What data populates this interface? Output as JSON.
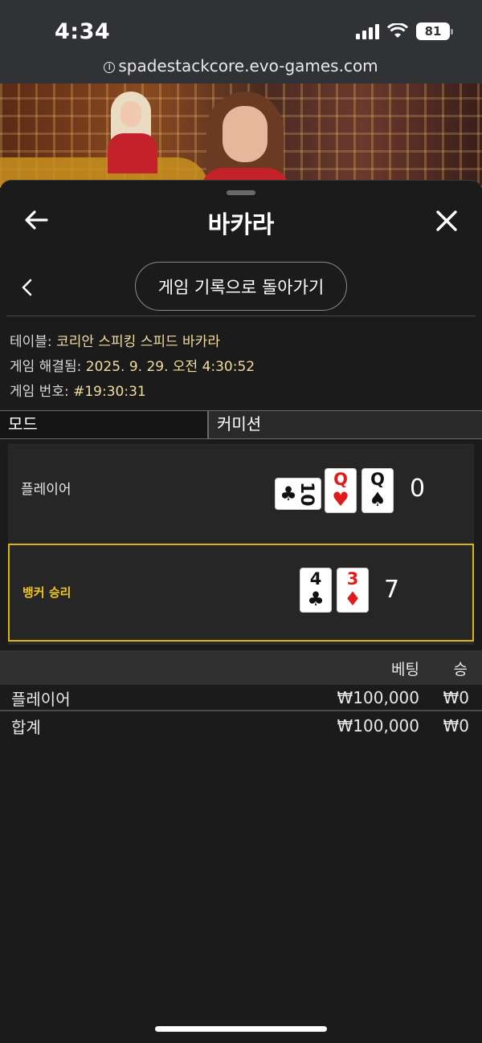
{
  "status": {
    "time": "4:34",
    "battery": "81"
  },
  "browser": {
    "url": "spadestackcore.evo-games.com"
  },
  "header": {
    "title": "바카라"
  },
  "history_button": "게임 기록으로 돌아가기",
  "info": {
    "table_label": "테이블:",
    "table_value": "코리안 스피킹 스피드 바카라",
    "resolved_label": "게임 해결됨:",
    "resolved_value": "2025. 9. 29. 오전 4:30:52",
    "number_label": "게임 번호:",
    "number_value": "#19:30:31"
  },
  "tabs": {
    "mode": "모드",
    "commission": "커미션"
  },
  "results": {
    "player": {
      "label": "플레이어",
      "score": "0",
      "cards": [
        {
          "rank": "10",
          "suit": "♣",
          "color": "#111111"
        },
        {
          "rank": "Q",
          "suit": "♥",
          "color": "#e11a1a"
        },
        {
          "rank": "Q",
          "suit": "♠",
          "color": "#111111"
        }
      ]
    },
    "banker": {
      "label": "뱅커 승리",
      "score": "7",
      "cards": [
        {
          "rank": "4",
          "suit": "♣",
          "color": "#111111"
        },
        {
          "rank": "3",
          "suit": "♦",
          "color": "#e11a1a"
        }
      ]
    }
  },
  "bets": {
    "col_bet": "베팅",
    "col_win": "승",
    "rows": [
      {
        "name": "플레이어",
        "bet": "₩100,000",
        "win": "₩0"
      }
    ],
    "total": {
      "name": "합계",
      "bet": "₩100,000",
      "win": "₩0"
    }
  },
  "colors": {
    "accent_win": "#d8b31a",
    "info_value": "#f1dd9e",
    "suit_red": "#e11a1a"
  }
}
